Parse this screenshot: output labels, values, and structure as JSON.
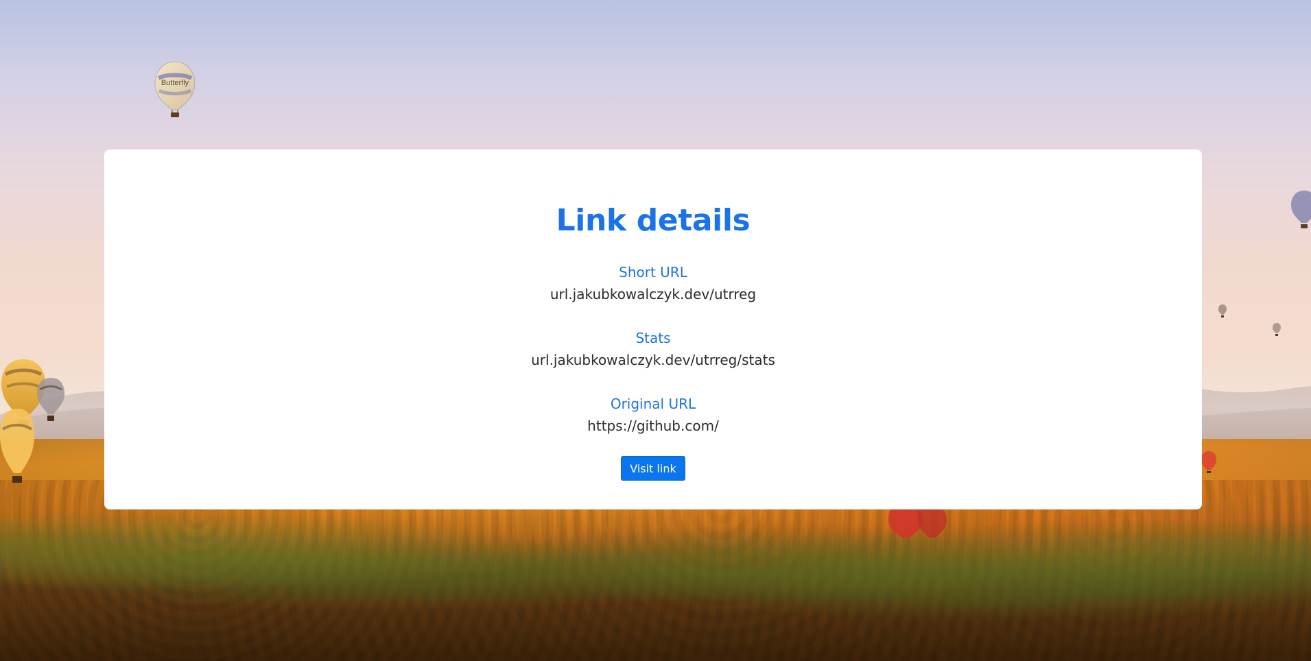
{
  "card": {
    "title": "Link details",
    "sections": [
      {
        "label": "Short URL",
        "value": "url.jakubkowalczyk.dev/utrreg"
      },
      {
        "label": "Stats",
        "value": "url.jakubkowalczyk.dev/utrreg/stats"
      },
      {
        "label": "Original URL",
        "value": "https://github.com/"
      }
    ],
    "button_label": "Visit link"
  },
  "background": {
    "balloons": {
      "top_left_text": "Butterfly"
    }
  },
  "colors": {
    "accent_blue": "#1a73e8",
    "button_blue": "#0b74ef",
    "text_dark": "#2b2b2b",
    "card_bg": "#ffffff"
  }
}
